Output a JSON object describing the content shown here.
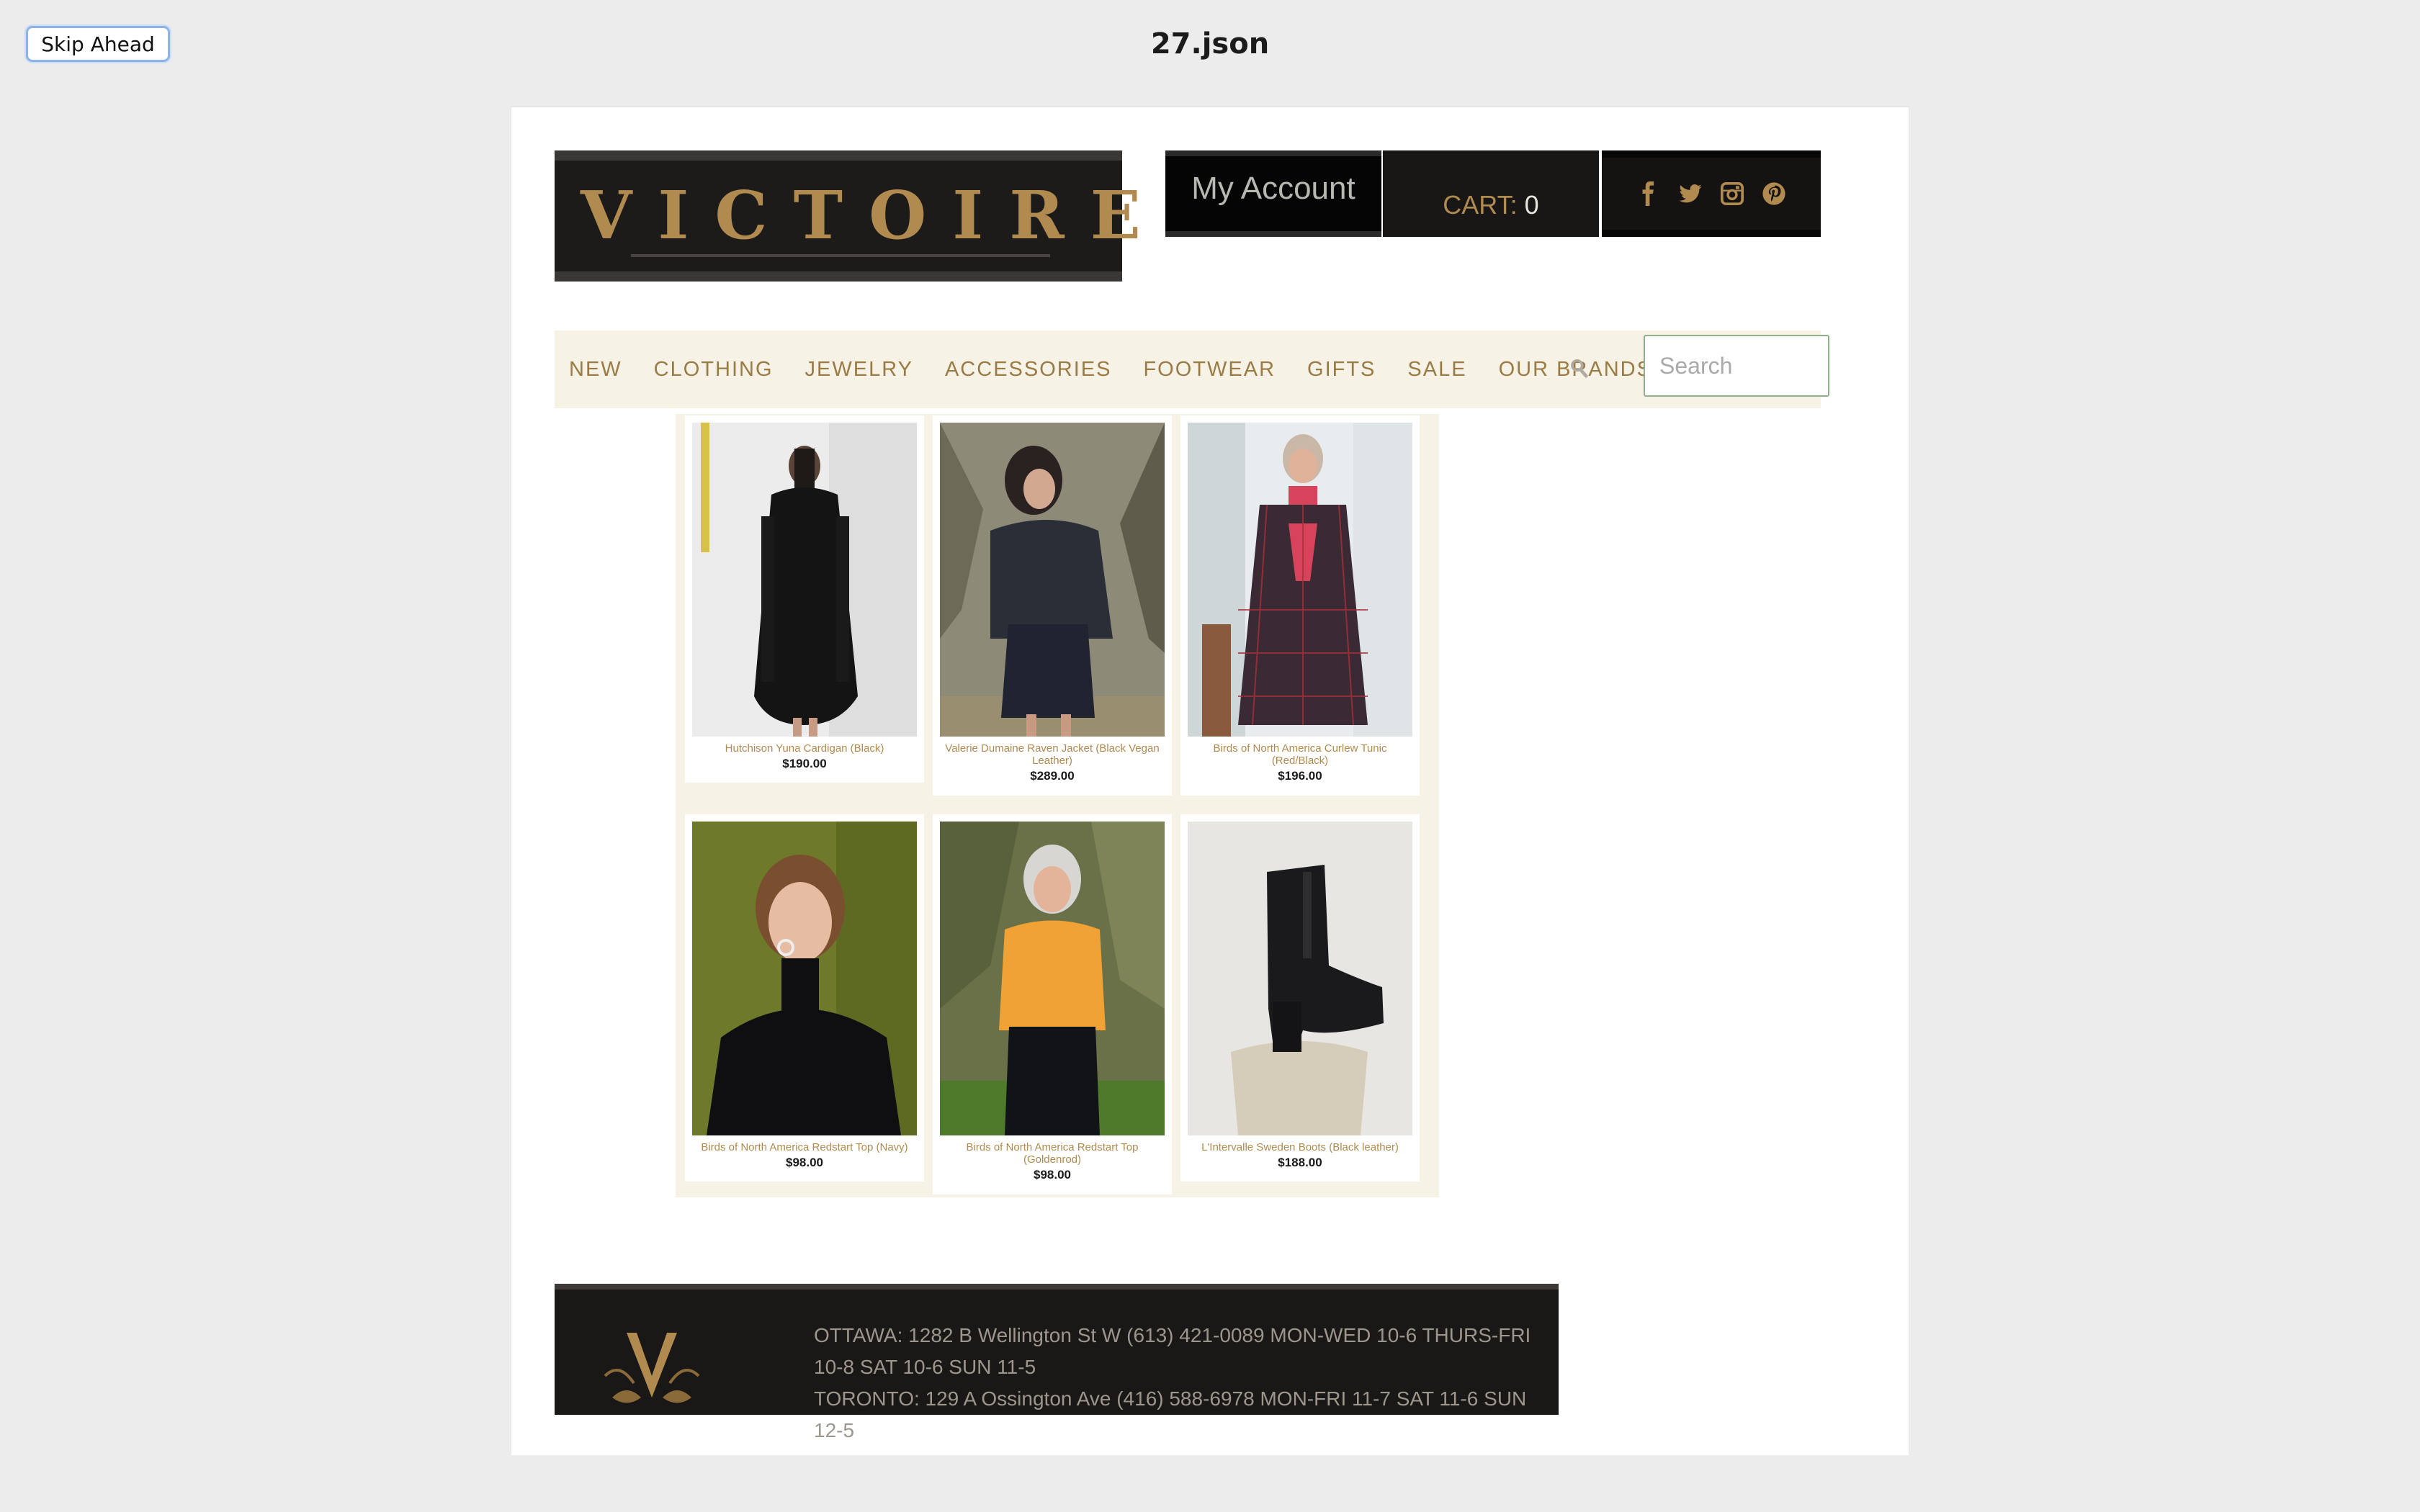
{
  "top_bar": {
    "skip_label": "Skip Ahead",
    "title": "27.json"
  },
  "header": {
    "logo_text": "VICTOIRE",
    "account_label": "My Account",
    "cart_label": "CART: ",
    "cart_count": "0",
    "social": [
      "facebook-icon",
      "twitter-icon",
      "instagram-icon",
      "pinterest-icon"
    ]
  },
  "nav": {
    "items": [
      "NEW",
      "CLOTHING",
      "JEWELRY",
      "ACCESSORIES",
      "FOOTWEAR",
      "GIFTS",
      "SALE",
      "OUR BRANDS"
    ],
    "search_placeholder": "Search"
  },
  "products": [
    {
      "name": "Hutchison Yuna Cardigan (Black)",
      "price": "$190.00"
    },
    {
      "name": "Valerie Dumaine Raven Jacket (Black Vegan Leather)",
      "price": "$289.00"
    },
    {
      "name": "Birds of North America Curlew Tunic (Red/Black)",
      "price": "$196.00"
    },
    {
      "name": "Birds of North America Redstart Top (Navy)",
      "price": "$98.00"
    },
    {
      "name": "Birds of North America Redstart Top (Goldenrod)",
      "price": "$98.00"
    },
    {
      "name": "L'Intervalle Sweden Boots (Black leather)",
      "price": "$188.00"
    }
  ],
  "footer": {
    "ottawa": "OTTAWA: 1282 B Wellington St W (613) 421-0089 MON-WED 10-6 THURS-FRI 10-8 SAT 10-6 SUN 11-5",
    "toronto": "TORONTO: 129 A Ossington Ave (416) 588-6978 MON-FRI 11-7 SAT 11-6 SUN 12-5"
  },
  "colors": {
    "brand_gold": "#b08a4f",
    "nav_bg": "#f6f2e6",
    "header_dark": "#1d1b1a"
  }
}
